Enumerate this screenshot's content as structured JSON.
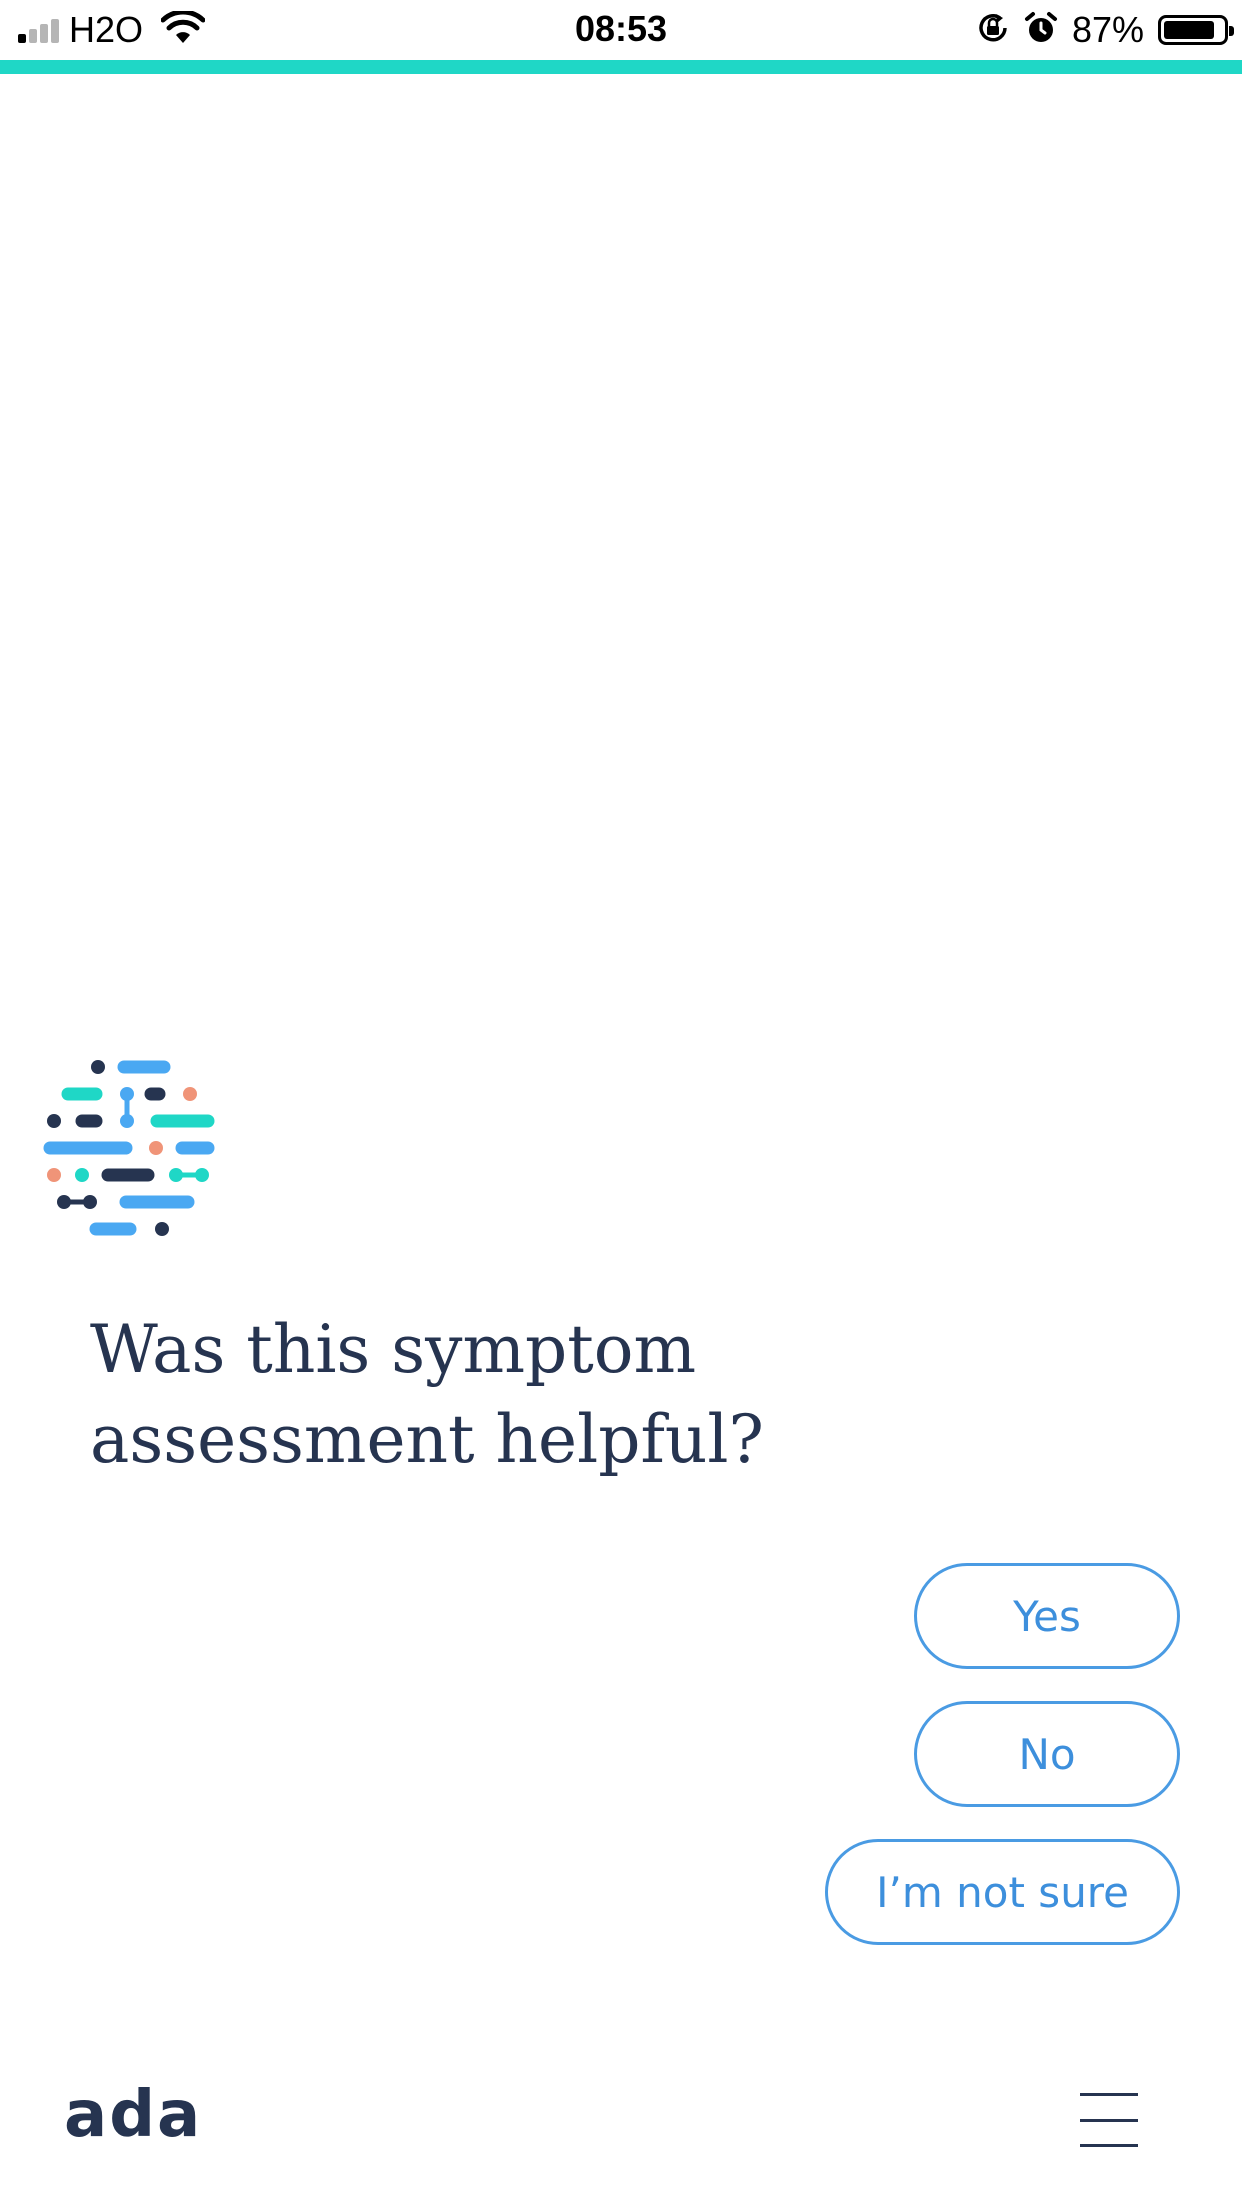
{
  "status_bar": {
    "carrier": "H2O",
    "time": "08:53",
    "battery_percent_label": "87%",
    "battery_level": 0.87,
    "signal_bars_active": 1,
    "signal_bars_total": 4,
    "icons": [
      "signal-bars-icon",
      "wifi-icon",
      "orientation-lock-icon",
      "alarm-icon",
      "battery-icon"
    ]
  },
  "progress": {
    "fraction": 1.0,
    "color": "#1fd7c6"
  },
  "conversation": {
    "question": "Was this symptom assessment helpful?",
    "answers": [
      {
        "label": "Yes"
      },
      {
        "label": "No"
      },
      {
        "label": "I’m not sure"
      }
    ]
  },
  "footer": {
    "brand": "ada",
    "menu_icon": "hamburger-menu-icon"
  },
  "colors": {
    "text_dark": "#263450",
    "accent_blue": "#3d8fdc",
    "teal": "#1fd7c6",
    "salmon": "#f09478",
    "light_blue": "#4aa8f2"
  }
}
